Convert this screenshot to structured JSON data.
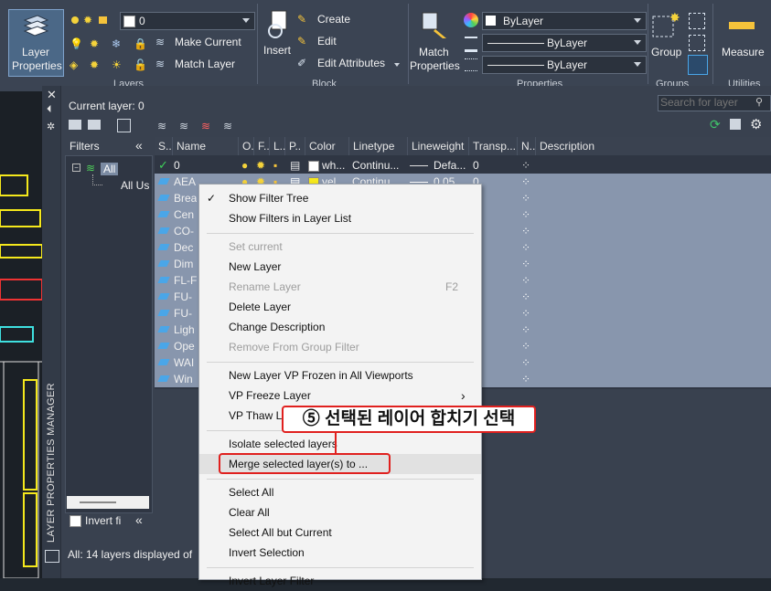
{
  "ribbon": {
    "layer_properties_label_1": "Layer",
    "layer_properties_label_2": "Properties",
    "layer_combo_value": "0",
    "make_current": "Make Current",
    "match_layer": "Match Layer",
    "insert": "Insert",
    "create": "Create",
    "edit": "Edit",
    "edit_attributes": "Edit Attributes",
    "match_properties_1": "Match",
    "match_properties_2": "Properties",
    "color_value": "ByLayer",
    "linetype_value": "ByLayer",
    "lineweight_value": "ByLayer",
    "group": "Group",
    "measure": "Measure",
    "panel_layers": "Layers",
    "panel_block": "Block",
    "panel_properties": "Properties",
    "panel_groups": "Groups",
    "panel_utilities": "Utilities"
  },
  "lpm": {
    "current_layer": "Current layer: 0",
    "search_placeholder": "Search for layer",
    "side_title": "LAYER PROPERTIES MANAGER",
    "filters_title": "Filters",
    "tree_all": "All",
    "tree_all_used": "All Us",
    "invert_filter": "Invert fi",
    "status": "All: 14 layers displayed of"
  },
  "grid": {
    "headers": [
      "S..",
      "Name",
      "O..",
      "F..",
      "L..",
      "P..",
      "Color",
      "Linetype",
      "Lineweight",
      "Transp...",
      "N..",
      "Description"
    ],
    "rows": [
      {
        "name": "0",
        "color": "wh...",
        "linetype": "Continu...",
        "lineweight": "Defa...",
        "transp": "0"
      },
      {
        "name": "AEA",
        "color": "yel...",
        "linetype": "Continu...",
        "lineweight": "0.05...",
        "transp": "0"
      },
      {
        "name": "Brea"
      },
      {
        "name": "Cen"
      },
      {
        "name": "CO-"
      },
      {
        "name": "Dec"
      },
      {
        "name": "Dim"
      },
      {
        "name": "FL-F"
      },
      {
        "name": "FU-"
      },
      {
        "name": "FU-"
      },
      {
        "name": "Ligh"
      },
      {
        "name": "Ope"
      },
      {
        "name": "WAI"
      },
      {
        "name": "Win"
      }
    ]
  },
  "context_menu": {
    "items": [
      {
        "label": "Show Filter Tree",
        "checked": true
      },
      {
        "label": "Show Filters in Layer List"
      },
      {
        "label": "Set current",
        "disabled": true
      },
      {
        "label": "New Layer"
      },
      {
        "label": "Rename Layer",
        "shortcut": "F2",
        "disabled": true
      },
      {
        "label": "Delete Layer"
      },
      {
        "label": "Change Description"
      },
      {
        "label": "Remove From Group Filter",
        "disabled": true
      },
      {
        "label": "New Layer VP Frozen in All Viewports"
      },
      {
        "label": "VP Freeze Layer"
      },
      {
        "label": "VP Thaw Layer"
      },
      {
        "label": "Isolate selected layers"
      },
      {
        "label": "Merge selected layer(s) to ..."
      },
      {
        "label": "Select All"
      },
      {
        "label": "Clear All"
      },
      {
        "label": "Select All but Current"
      },
      {
        "label": "Invert Selection"
      },
      {
        "label": "Invert Layer Filter"
      }
    ],
    "check_mark": "✓",
    "submenu_arrow": "›"
  },
  "annotation": {
    "callout": "⑤ 선택된 레이어 합치기 선택",
    "color": "#e0201e"
  },
  "colors": {
    "accent_blue": "#4aa6e8",
    "selected_row": "#8896ad",
    "yellow_layer": "#f5e81c"
  }
}
